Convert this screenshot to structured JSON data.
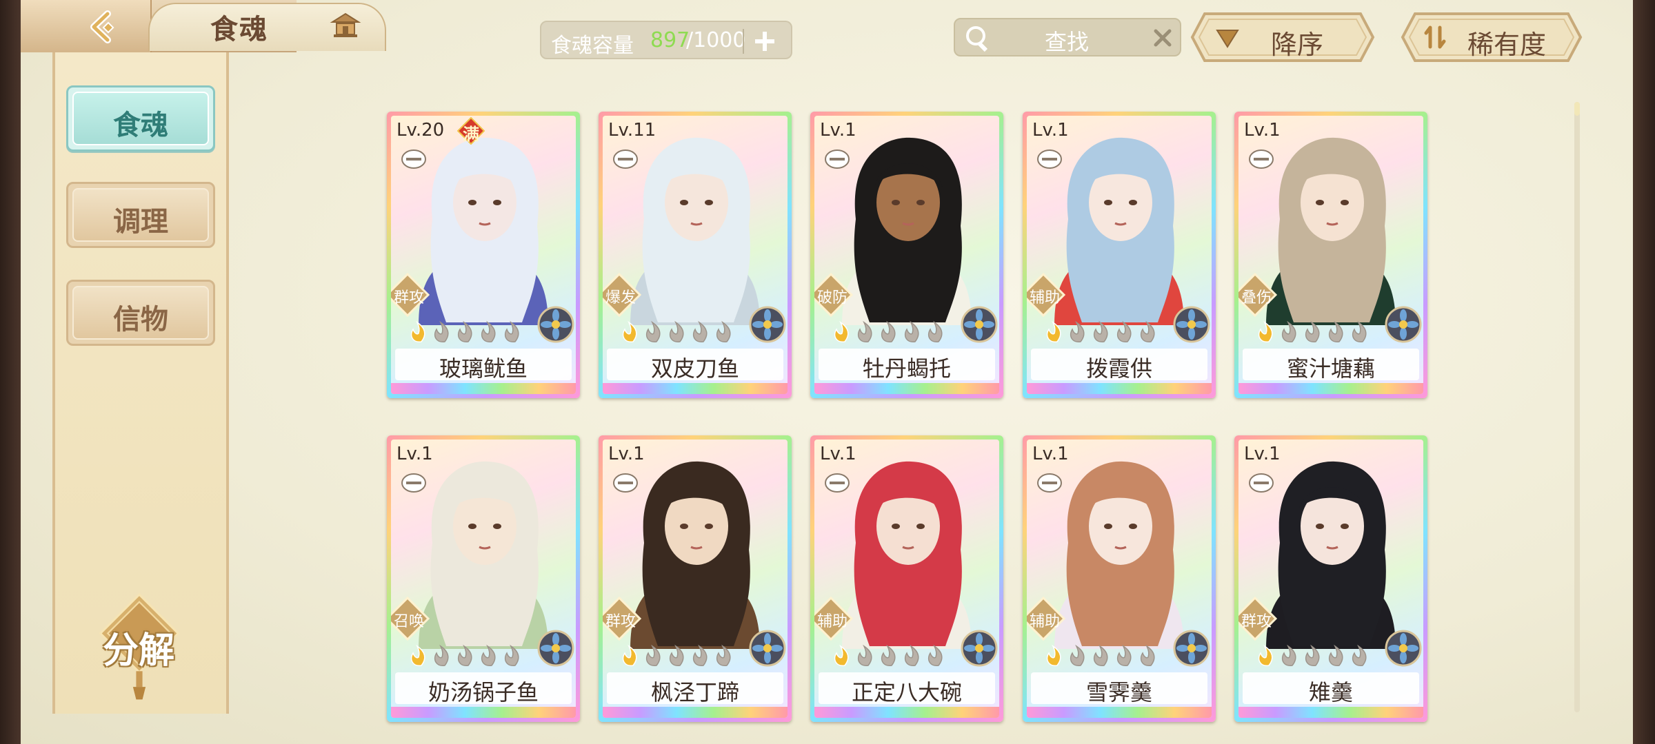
{
  "header": {
    "title": "食魂",
    "capacity": {
      "label": "食魂容量",
      "current": "897",
      "max": "/1000"
    },
    "search": {
      "text": "查找"
    },
    "sort_label": "降序",
    "rarity_label": "稀有度"
  },
  "sidebar": {
    "items": [
      {
        "label": "食魂",
        "active": true
      },
      {
        "label": "调理",
        "active": false
      },
      {
        "label": "信物",
        "active": false
      }
    ],
    "decompose_label": "分解"
  },
  "cards": [
    {
      "level": "Lv.20",
      "max_badge": "满",
      "role": "群攻",
      "name": "玻璃鱿鱼",
      "stars_lit": 1,
      "hair": "#e7edf7",
      "outfit": "#5b63b8",
      "skin": "#f4e7e4"
    },
    {
      "level": "Lv.11",
      "role": "爆发",
      "name": "双皮刀鱼",
      "stars_lit": 1,
      "hair": "#e5eef3",
      "outfit": "#c9d6de",
      "skin": "#f5e6dc"
    },
    {
      "level": "Lv.1",
      "role": "破防",
      "name": "牡丹蝎托",
      "stars_lit": 1,
      "hair": "#1d1b1a",
      "outfit": "#f3f1e6",
      "skin": "#a7744c"
    },
    {
      "level": "Lv.1",
      "role": "辅助",
      "name": "拨霞供",
      "stars_lit": 1,
      "hair": "#aecbe3",
      "outfit": "#e0463e",
      "skin": "#f7e7de"
    },
    {
      "level": "Lv.1",
      "role": "叠伤",
      "name": "蜜汁塘藕",
      "stars_lit": 1,
      "hair": "#c5b49b",
      "outfit": "#1f3d2e",
      "skin": "#f5e2d2"
    },
    {
      "level": "Lv.1",
      "role": "召唤",
      "name": "奶汤锅子鱼",
      "stars_lit": 1,
      "hair": "#ece8dc",
      "outfit": "#b9d2a6",
      "skin": "#f5e6d6"
    },
    {
      "level": "Lv.1",
      "role": "群攻",
      "name": "枫泾丁蹄",
      "stars_lit": 1,
      "hair": "#3a2a20",
      "outfit": "#6b4a30",
      "skin": "#f0d9c2"
    },
    {
      "level": "Lv.1",
      "role": "辅助",
      "name": "正定八大碗",
      "stars_lit": 1,
      "hair": "#d43a48",
      "outfit": "#f2efe5",
      "skin": "#f5dfd2"
    },
    {
      "level": "Lv.1",
      "role": "辅助",
      "name": "雪霁羹",
      "stars_lit": 1,
      "hair": "#c88865",
      "outfit": "#efe6ef",
      "skin": "#f7e6dc"
    },
    {
      "level": "Lv.1",
      "role": "群攻",
      "name": "雉羹",
      "stars_lit": 1,
      "hair": "#1f1f24",
      "outfit": "#1e1d22",
      "skin": "#f5e4dc"
    }
  ],
  "colors": {
    "accent_teal": "#8ac7c2",
    "capacity_green": "#8fdb52",
    "role_badge": "#c9a56a",
    "text_brown": "#6b4a33"
  }
}
